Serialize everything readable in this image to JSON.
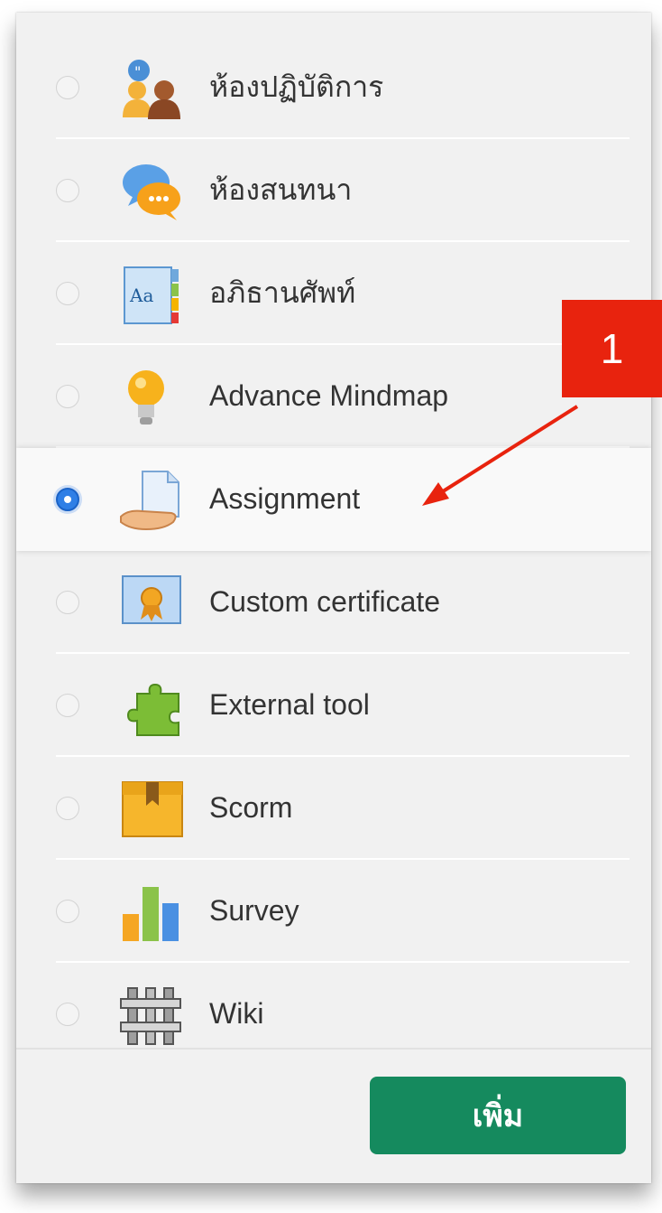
{
  "modules": [
    {
      "label": "ห้องปฏิบัติการ",
      "icon": "workshop-icon",
      "selected": false
    },
    {
      "label": "ห้องสนทนา",
      "icon": "chat-icon",
      "selected": false
    },
    {
      "label": "อภิธานศัพท์",
      "icon": "glossary-icon",
      "selected": false
    },
    {
      "label": "Advance Mindmap",
      "icon": "lightbulb-icon",
      "selected": false
    },
    {
      "label": "Assignment",
      "icon": "assignment-icon",
      "selected": true
    },
    {
      "label": "Custom certificate",
      "icon": "certificate-icon",
      "selected": false
    },
    {
      "label": "External tool",
      "icon": "puzzle-icon",
      "selected": false
    },
    {
      "label": "Scorm",
      "icon": "package-icon",
      "selected": false
    },
    {
      "label": "Survey",
      "icon": "bar-chart-icon",
      "selected": false
    },
    {
      "label": "Wiki",
      "icon": "wiki-icon",
      "selected": false
    }
  ],
  "footer": {
    "add_label": "เพิ่ม"
  },
  "annotation": {
    "marker": "1",
    "color": "#e8230e"
  },
  "colors": {
    "add_button": "#158a5e",
    "radio_checked": "#2f7fe6"
  }
}
